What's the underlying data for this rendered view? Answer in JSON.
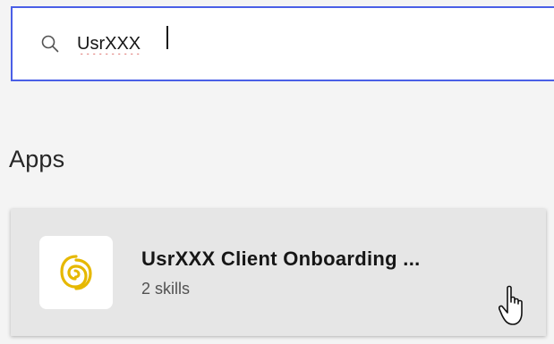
{
  "search": {
    "value": "UsrXXX",
    "icon": "search-icon"
  },
  "section": {
    "title": "Apps"
  },
  "app_card": {
    "name": "UsrXXX Client Onboarding ...",
    "skills": "2 skills",
    "logo": "app-logo-icon",
    "logo_color": "#e6b800"
  },
  "colors": {
    "focus_border": "#4a5fe6",
    "background": "#f4f4f4",
    "card": "#e6e6e6"
  }
}
